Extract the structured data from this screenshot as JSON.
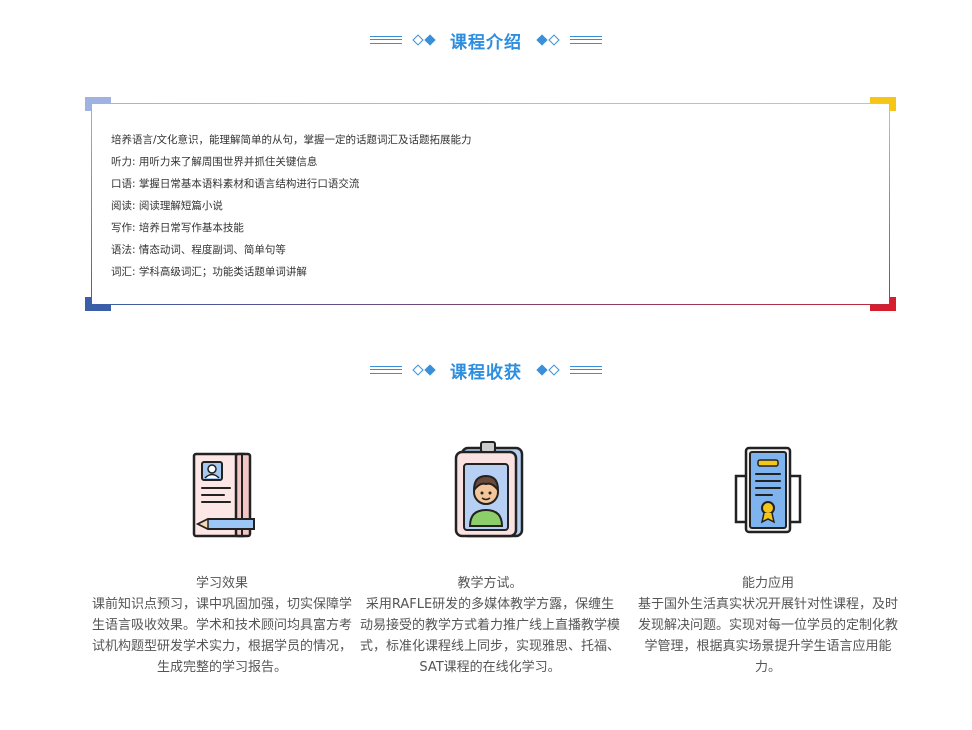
{
  "section1": {
    "title": "课程介绍"
  },
  "intro": {
    "lines": [
      "培养语言/文化意识，能理解简单的从句，掌握一定的话题词汇及话题拓展能力",
      "听力: 用听力来了解周围世界并抓住关键信息",
      "口语: 掌握日常基本语料素材和语言结构进行口语交流",
      "阅读: 阅读理解短篇小说",
      "写作: 培养日常写作基本技能",
      "语法: 情态动词、程度副词、简单句等",
      "词汇: 学科高级词汇；功能类话题单词讲解"
    ]
  },
  "section2": {
    "title": "课程收获"
  },
  "gains": [
    {
      "title": "学习效果",
      "desc": "课前知识点预习，课中巩固加强，切实保障学生语言吸收效果。学术和技术顾问均具富方考试机构题型研发学术实力，根据学员的情况，生成完整的学习报告。",
      "icon": "profile-notebook-icon"
    },
    {
      "title": "教学方试。",
      "desc": "采用RAFLE研发的多媒体教学方露，保缠生动易接受的教学方式着力推广线上直播教学模式，标准化课程线上同步，实现雅思、托福、SAT课程的在线化学习。",
      "icon": "id-badge-icon"
    },
    {
      "title": "能力应用",
      "desc": "基于国外生活真实状况开展针对性课程，及时发现解决问题。实现对每一位学员的定制化教学管理，根据真实场景提升学生语言应用能力。",
      "icon": "certificate-icon"
    }
  ],
  "colors": {
    "accent": "#2d8ee0",
    "corner_tl": "#9fb3e0",
    "corner_tr": "#f5c518",
    "corner_bl": "#3a5fa8",
    "corner_br": "#d81e2e"
  }
}
